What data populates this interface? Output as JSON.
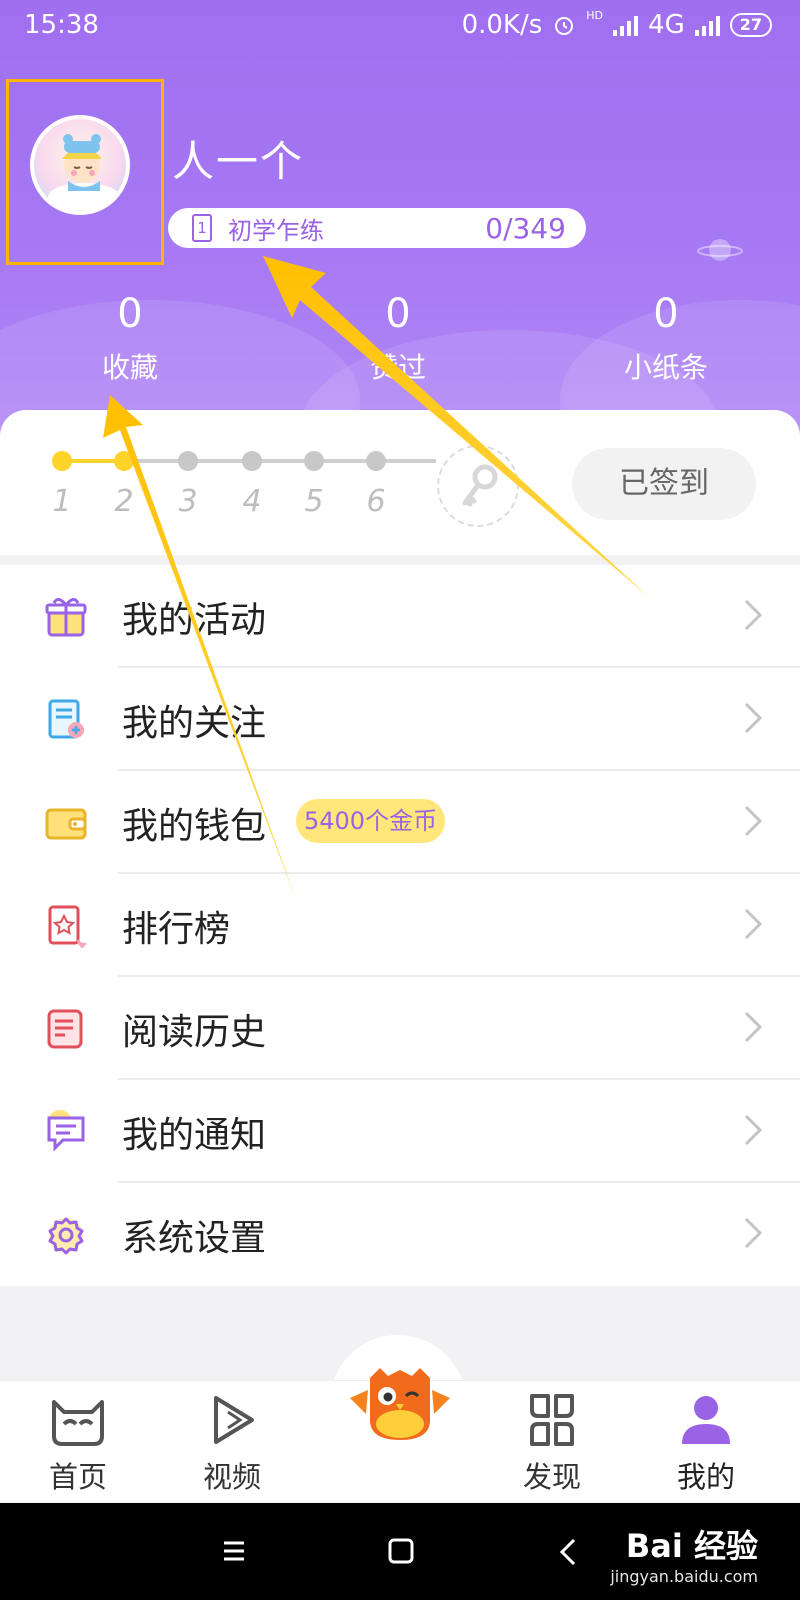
{
  "status_bar": {
    "time": "15:38",
    "speed": "0.0K/s",
    "hd": "HD",
    "network": "4G",
    "battery": "27"
  },
  "profile": {
    "username": "人一个",
    "level_icon_number": "1",
    "level_title": "初学乍练",
    "level_progress": "0/349",
    "accent_color": "#a779f4",
    "highlight_color": "#ffb400"
  },
  "stats": [
    {
      "value": "0",
      "label": "收藏"
    },
    {
      "value": "0",
      "label": "赞过"
    },
    {
      "value": "0",
      "label": "小纸条"
    }
  ],
  "checkin": {
    "days": [
      "1",
      "2",
      "3",
      "4",
      "5",
      "6"
    ],
    "days_completed": 2,
    "button_label": "已签到",
    "key_icon": "key-icon"
  },
  "menu": [
    {
      "label": "我的活动",
      "icon": "gift-icon"
    },
    {
      "label": "我的关注",
      "icon": "follow-list-icon"
    },
    {
      "label": "我的钱包",
      "icon": "wallet-icon",
      "badge": "5400个金币"
    },
    {
      "label": "排行榜",
      "icon": "ranking-icon"
    },
    {
      "label": "阅读历史",
      "icon": "history-icon"
    },
    {
      "label": "我的通知",
      "icon": "notification-icon"
    },
    {
      "label": "系统设置",
      "icon": "settings-icon"
    }
  ],
  "tabs": [
    {
      "label": "首页",
      "icon": "home-cat-icon"
    },
    {
      "label": "视频",
      "icon": "video-play-icon"
    },
    {
      "label": "",
      "icon": "owl-mascot-icon"
    },
    {
      "label": "发现",
      "icon": "discover-icon"
    },
    {
      "label": "我的",
      "icon": "profile-icon",
      "active": true
    }
  ],
  "watermark": {
    "brand": "Bai 经验",
    "url": "jingyan.baidu.com"
  }
}
